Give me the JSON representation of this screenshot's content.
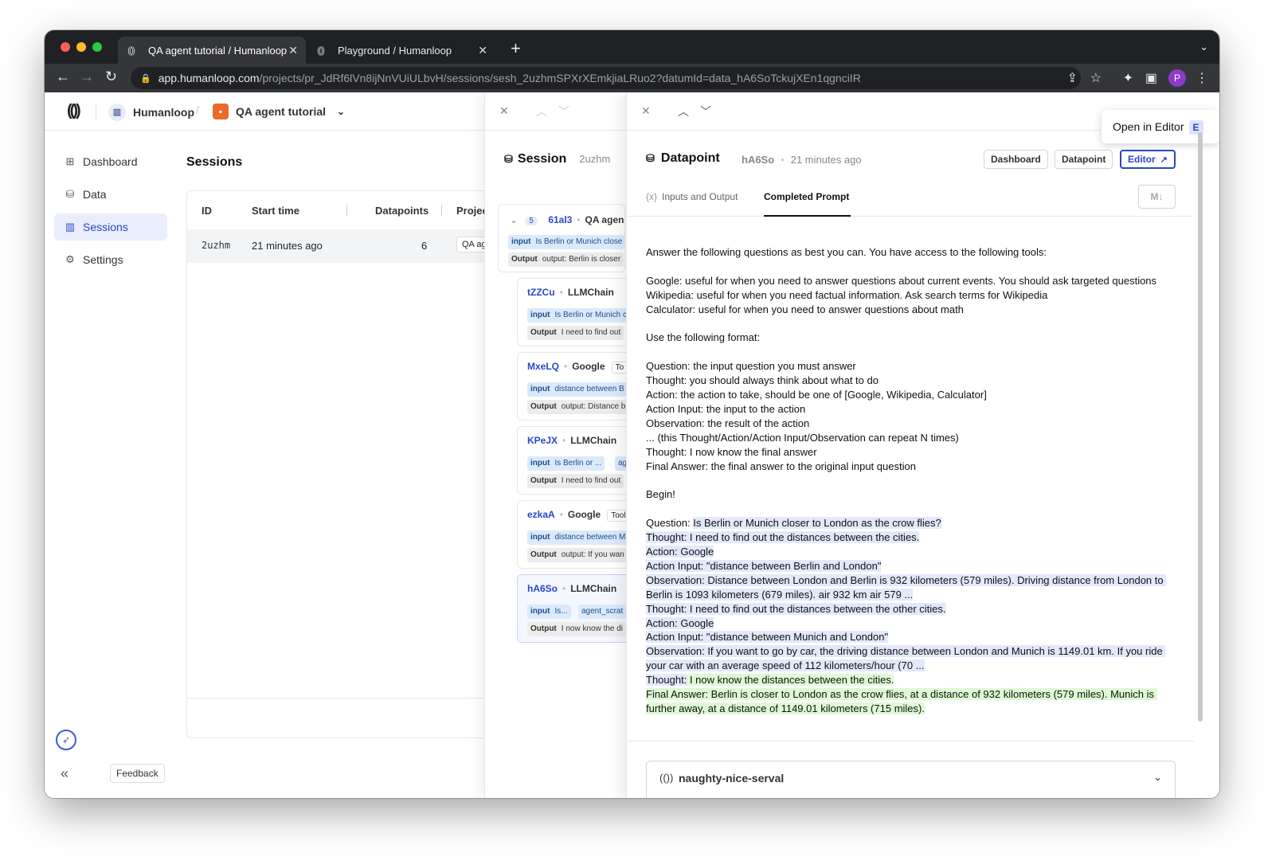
{
  "browser": {
    "tabs": [
      {
        "title": "QA agent tutorial / Humanloop",
        "active": true
      },
      {
        "title": "Playground / Humanloop",
        "active": false
      }
    ],
    "url_host": "app.humanloop.com",
    "url_path": "/projects/pr_JdRf6lVn8ijNnVUiULbvH/sessions/sesh_2uzhmSPXrXEmkjiaLRuo2?datumId=data_hA6SoTckujXEn1qgnciIR",
    "profile_initial": "P"
  },
  "topnav": {
    "org": "Humanloop",
    "project": "QA agent tutorial"
  },
  "sidebar": {
    "items": [
      {
        "label": "Dashboard",
        "icon": "grid-icon"
      },
      {
        "label": "Data",
        "icon": "database-icon"
      },
      {
        "label": "Sessions",
        "icon": "columns-icon"
      },
      {
        "label": "Settings",
        "icon": "gear-icon"
      }
    ],
    "feedback_label": "Feedback"
  },
  "sessions": {
    "title": "Sessions",
    "columns": [
      "ID",
      "Start time",
      "Datapoints",
      "Projec"
    ],
    "rows": [
      {
        "id": "2uzhm",
        "start": "21 minutes ago",
        "datapoints": "6",
        "project": "QA ag"
      }
    ]
  },
  "session_panel": {
    "title": "Session",
    "id": "2uzhm",
    "root": {
      "count": "5",
      "id": "61al3",
      "type": "QA agen",
      "input": "Is Berlin or Munich close",
      "output": "output: Berlin is closer"
    },
    "runs": [
      {
        "id": "tZZCu",
        "type": "LLMChain",
        "input": "Is Berlin or Munich c",
        "output": "I need to find out"
      },
      {
        "id": "MxeLQ",
        "type": "Google",
        "tag": "To",
        "input": "distance between B",
        "output": "output: Distance b"
      },
      {
        "id": "KPeJX",
        "type": "LLMChain",
        "input": "Is Berlin or ...",
        "extra": "ag",
        "output": "I need to find out"
      },
      {
        "id": "ezkaA",
        "type": "Google",
        "tag": "Tool",
        "input": "distance between M",
        "output": "output: If you wan"
      },
      {
        "id": "hA6So",
        "type": "LLMChain",
        "input": "Is...",
        "extra": "agent_scrat",
        "output": "I now know the di"
      }
    ],
    "input_label": "input",
    "output_label": "Output"
  },
  "datapoint": {
    "title": "Datapoint",
    "id": "hA6So",
    "time": "21 minutes ago",
    "buttons": {
      "dashboard": "Dashboard",
      "datapoint": "Datapoint",
      "editor": "Editor"
    },
    "tooltip": {
      "label": "Open in Editor",
      "key": "E"
    },
    "tabs": [
      {
        "label": "Inputs and Output",
        "prefix": "{x}"
      },
      {
        "label": "Completed Prompt"
      }
    ],
    "md_label": "M↓",
    "prompt_intro": "Answer the following questions as best you can. You have access to the following tools:\n\nGoogle: useful for when you need to answer questions about current events. You should ask targeted questions\nWikipedia: useful for when you need factual information. Ask search terms for Wikipedia\nCalculator: useful for when you need to answer questions about math\n\nUse the following format:\n\nQuestion: the input question you must answer\nThought: you should always think about what to do\nAction: the action to take, should be one of [Google, Wikipedia, Calculator]\nAction Input: the input to the action\nObservation: the result of the action\n... (this Thought/Action/Action Input/Observation can repeat N times)\nThought: I now know the final answer\nFinal Answer: the final answer to the original input question\n\nBegin!\n\n",
    "question_prefix": "Question: ",
    "question": "Is Berlin or Munich closer to London as the crow flies?",
    "scratchpad": "Thought: I need to find out the distances between the cities.\nAction: Google\nAction Input: \"distance between Berlin and London\"\nObservation: Distance between London and Berlin is 932 kilometers (579 miles). Driving distance from London to Berlin is 1093 kilometers (679 miles). air 932 km air 579 ...\nThought: I need to find out the distances between the other cities.\nAction: Google\nAction Input: \"distance between Munich and London\"\nObservation: If you want to go by car, the driving distance between London and Munich is 1149.01 km. If you ride your car with an average speed of 112 kilometers/hour (70 ...\nThought:",
    "completion": " I now know the distances between the cities.\nFinal Answer: Berlin is closer to London as the crow flies, at a distance of 932 kilometers (579 miles). Munich is further away, at a distance of 1149.01 kilometers (715 miles).",
    "model": "naughty-nice-serval"
  }
}
